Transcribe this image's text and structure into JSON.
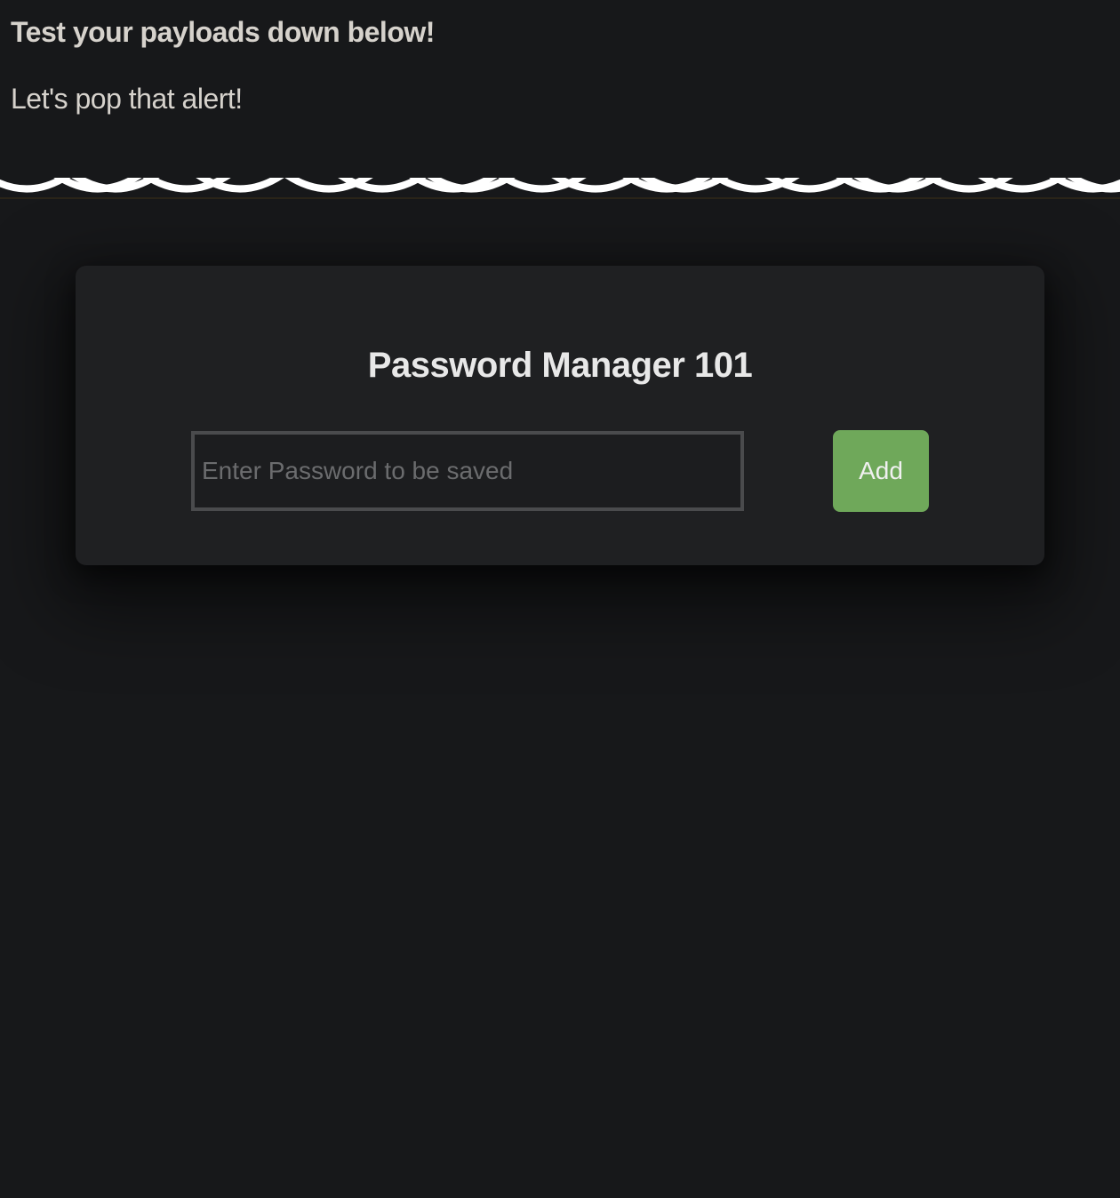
{
  "top": {
    "heading": "Test your payloads down below!",
    "subheading": "Let's pop that alert!"
  },
  "card": {
    "title": "Password Manager 101",
    "input_placeholder": "Enter Password to be saved",
    "add_button_label": "Add"
  }
}
